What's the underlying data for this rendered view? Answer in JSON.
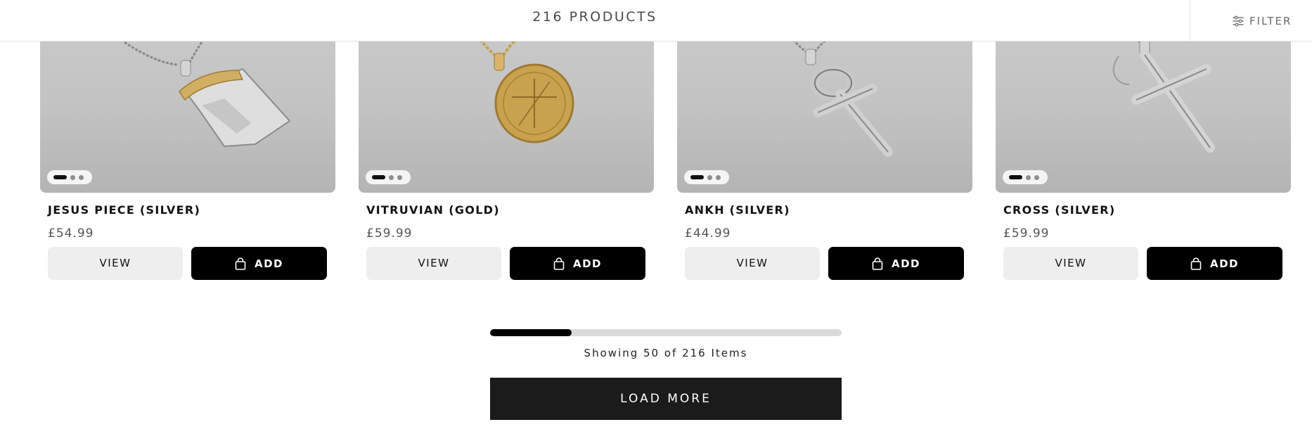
{
  "header": {
    "product_count": "216 PRODUCTS",
    "filter_label": "FILTER",
    "filter_icon": "sliders-icon"
  },
  "products": [
    {
      "title": "JESUS PIECE (SILVER)",
      "price": "£54.99",
      "view_label": "VIEW",
      "add_label": "ADD"
    },
    {
      "title": "VITRUVIAN (GOLD)",
      "price": "£59.99",
      "view_label": "VIEW",
      "add_label": "ADD"
    },
    {
      "title": "ANKH (SILVER)",
      "price": "£44.99",
      "view_label": "VIEW",
      "add_label": "ADD"
    },
    {
      "title": "CROSS (SILVER)",
      "price": "£59.99",
      "view_label": "VIEW",
      "add_label": "ADD"
    }
  ],
  "pagination": {
    "showing_text": "Showing 50 of 216 Items",
    "shown": 50,
    "total": 216,
    "load_more_label": "LOAD MORE"
  },
  "colors": {
    "primary_button": "#000000",
    "secondary_button": "#eeeeee",
    "load_more_bg": "#1b1b1b",
    "gold": "#c9a24f",
    "silver": "#d9d9d9"
  }
}
